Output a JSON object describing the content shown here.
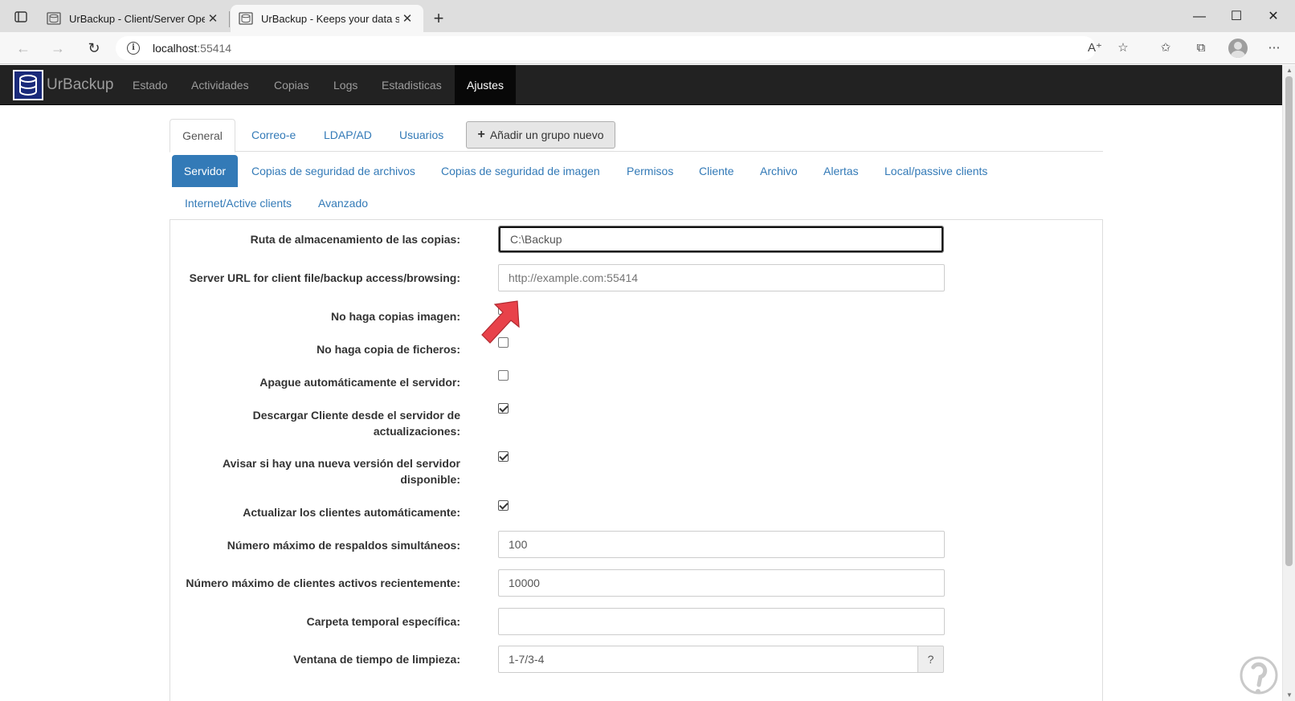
{
  "browser": {
    "tabs": [
      {
        "title": "UrBackup - Client/Server Open S",
        "close": "✕"
      },
      {
        "title": "UrBackup - Keeps your data safe",
        "close": "✕"
      }
    ],
    "new_tab": "+",
    "window": {
      "minimize": "—",
      "maximize": "☐",
      "close": "✕"
    },
    "address": {
      "host": "localhost",
      "port": ":55414"
    },
    "icons": [
      "back-icon",
      "forward-icon",
      "refresh-icon",
      "site-info-icon",
      "read-aloud-icon",
      "add-favorite-icon",
      "favorites-icon",
      "collections-icon",
      "profile-icon",
      "more-icon"
    ]
  },
  "app": {
    "brand": "UrBackup",
    "nav": [
      "Estado",
      "Actividades",
      "Copias",
      "Logs",
      "Estadisticas",
      "Ajustes"
    ],
    "active_nav": "Ajustes",
    "settings_tabs": [
      "General",
      "Correo-e",
      "LDAP/AD",
      "Usuarios"
    ],
    "add_group_label": "Añadir un grupo nuevo",
    "sections": [
      "Servidor",
      "Copias de seguridad de archivos",
      "Copias de seguridad de imagen",
      "Permisos",
      "Cliente",
      "Archivo",
      "Alertas",
      "Local/passive clients",
      "Internet/Active clients",
      "Avanzado"
    ],
    "active_section": "Servidor"
  },
  "form": {
    "storage_path": {
      "label": "Ruta de almacenamiento de las copias:",
      "value": "C:\\Backup"
    },
    "server_url": {
      "label": "Server URL for client file/backup access/browsing:",
      "placeholder": "http://example.com:55414"
    },
    "no_image_backups": {
      "label": "No haga copias imagen:",
      "checked": false
    },
    "no_file_backups": {
      "label": "No haga copia de ficheros:",
      "checked": false
    },
    "auto_shutdown": {
      "label": "Apague automáticamente el servidor:",
      "checked": false
    },
    "download_client": {
      "label_line1": "Descargar Cliente desde el servidor de",
      "label_line2": "actualizaciones:",
      "checked": true
    },
    "notify_new_version": {
      "label_line1": "Avisar si hay una nueva versión del servidor",
      "label_line2": "disponible:",
      "checked": true
    },
    "auto_update_clients": {
      "label": "Actualizar los clientes automáticamente:",
      "checked": true
    },
    "max_simultaneous": {
      "label": "Número máximo de respaldos simultáneos:",
      "value": "100"
    },
    "max_active_clients": {
      "label": "Número máximo de clientes activos recientemente:",
      "value": "10000"
    },
    "temp_folder": {
      "label": "Carpeta temporal específica:",
      "value": ""
    },
    "cleanup_window": {
      "label": "Ventana de tiempo de limpieza:",
      "value": "1-7/3-4",
      "help": "?"
    }
  },
  "colors": {
    "navbar": "#222222",
    "link": "#337ab7",
    "active_pill": "#337ab7",
    "arrow": "#e8424a"
  }
}
